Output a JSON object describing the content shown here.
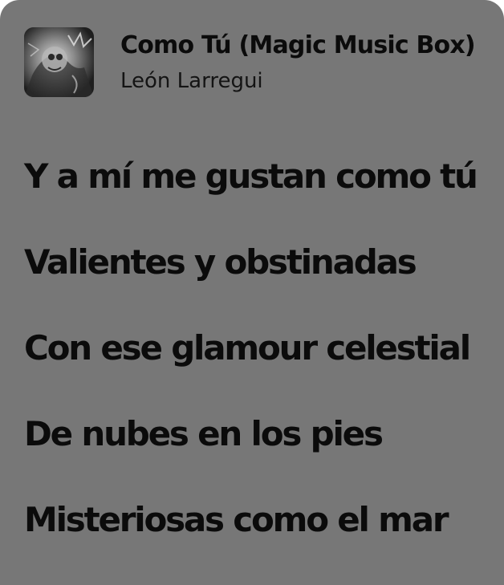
{
  "now_playing": {
    "title": "Como Tú (Magic Music Box)",
    "artist": "León Larregui",
    "artwork_icon": "album-artwork"
  },
  "lyrics": {
    "lines": [
      "Y a mí me gustan como tú",
      "Valientes y obstinadas",
      "Con ese glamour celestial",
      "De nubes en los pies",
      "Misteriosas como el mar"
    ]
  },
  "colors": {
    "background": "#777777",
    "text": "#0b0b0b"
  }
}
